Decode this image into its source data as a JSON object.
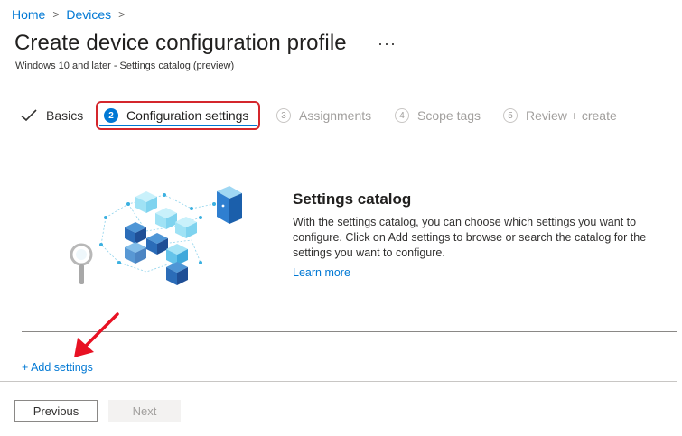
{
  "breadcrumb": {
    "items": [
      "Home",
      "Devices"
    ],
    "separator": ">"
  },
  "page": {
    "title": "Create device configuration profile",
    "more": "···",
    "subtitle": "Windows 10 and later - Settings catalog (preview)"
  },
  "wizard": {
    "steps": [
      {
        "number": "",
        "label": "Basics",
        "state": "done"
      },
      {
        "number": "2",
        "label": "Configuration settings",
        "state": "active"
      },
      {
        "number": "3",
        "label": "Assignments",
        "state": "pending"
      },
      {
        "number": "4",
        "label": "Scope tags",
        "state": "pending"
      },
      {
        "number": "5",
        "label": "Review + create",
        "state": "pending"
      }
    ]
  },
  "catalog": {
    "title": "Settings catalog",
    "description": "With the settings catalog, you can choose which settings you want to configure. Click on Add settings to browse or search the catalog for the settings you want to configure.",
    "learn_more": "Learn more",
    "illustration_icon": "settings-catalog-cubes-illustration"
  },
  "actions": {
    "add_settings": "+ Add settings"
  },
  "footer": {
    "previous": "Previous",
    "next": "Next"
  },
  "colors": {
    "accent": "#0078d4",
    "highlight": "#d4262c",
    "disabled": "#a19f9d"
  }
}
